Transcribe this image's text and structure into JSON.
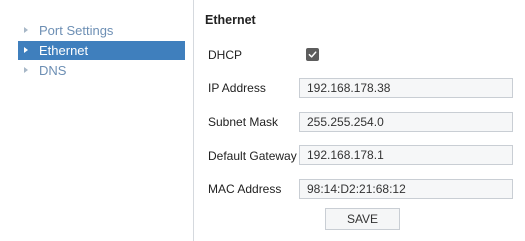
{
  "sidebar": {
    "items": [
      {
        "label": "Port Settings",
        "active": false
      },
      {
        "label": "Ethernet",
        "active": true
      },
      {
        "label": "DNS",
        "active": false
      }
    ]
  },
  "panel": {
    "title": "Ethernet",
    "dhcp_label": "DHCP",
    "dhcp_checked": true,
    "ip_label": "IP Address",
    "ip_value": "192.168.178.38",
    "mask_label": "Subnet Mask",
    "mask_value": "255.255.254.0",
    "gateway_label": "Default Gateway",
    "gateway_value": "192.168.178.1",
    "mac_label": "MAC Address",
    "mac_value": "98:14:D2:21:68:12",
    "save_label": "SAVE"
  },
  "colors": {
    "accent": "#3f7fbd",
    "nav_text": "#6d8fb4"
  },
  "icons": {
    "nav_arrow": "triangle-right-icon",
    "checkbox": "checkmark-icon"
  }
}
